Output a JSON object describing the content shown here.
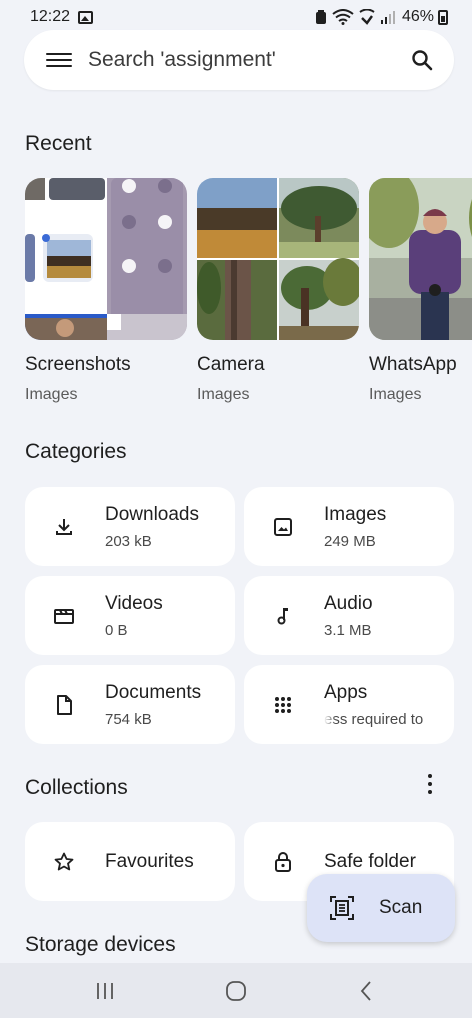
{
  "status": {
    "time": "12:22",
    "battery": "46%"
  },
  "search": {
    "placeholder": "Search 'assignment'"
  },
  "sections": {
    "recent": "Recent",
    "categories": "Categories",
    "collections": "Collections",
    "storage": "Storage devices"
  },
  "recent": [
    {
      "name": "Screenshots",
      "type": "Images"
    },
    {
      "name": "Camera",
      "type": "Images"
    },
    {
      "name": "WhatsApp",
      "type": "Images"
    }
  ],
  "categories": [
    {
      "name": "Downloads",
      "size": "203 kB",
      "icon": "download-icon"
    },
    {
      "name": "Images",
      "size": "249 MB",
      "icon": "image-icon"
    },
    {
      "name": "Videos",
      "size": "0 B",
      "icon": "video-icon"
    },
    {
      "name": "Audio",
      "size": "3.1 MB",
      "icon": "music-note-icon"
    },
    {
      "name": "Documents",
      "size": "754 kB",
      "icon": "document-icon"
    },
    {
      "name": "Apps",
      "size": "ess required to",
      "icon": "apps-grid-icon"
    }
  ],
  "collections": [
    {
      "name": "Favourites",
      "icon": "star-icon"
    },
    {
      "name": "Safe folder",
      "icon": "lock-icon"
    }
  ],
  "fab": {
    "label": "Scan"
  },
  "colors": {
    "background": "#f1f3f8",
    "card": "#ffffff",
    "fab": "#dde3f7",
    "navbar": "#e6e8ee",
    "text": "#1f1f1f"
  }
}
